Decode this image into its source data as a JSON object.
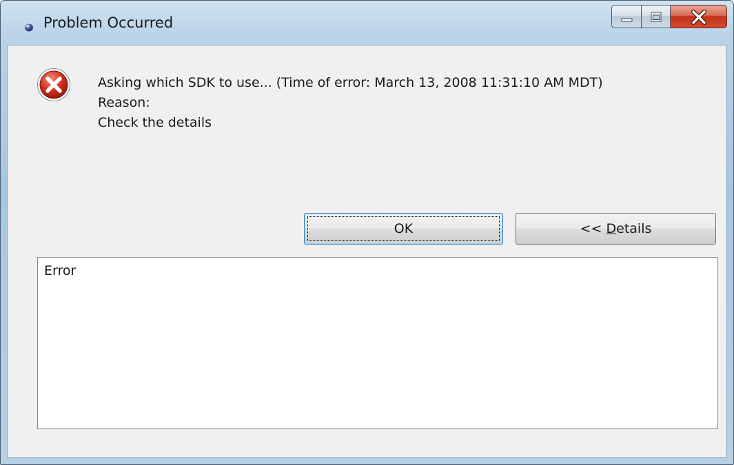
{
  "window": {
    "title": "Problem Occurred",
    "caption_buttons": [
      "minimize-icon",
      "maximize-icon",
      "close-icon"
    ],
    "accent_close": "#c2321a"
  },
  "message": {
    "icon": "error-icon",
    "line1": "Asking which SDK to use... (Time of error: March 13, 2008 11:31:10 AM MDT)",
    "line2": "Reason:",
    "line3": "Check the details"
  },
  "buttons": {
    "ok_label": "OK",
    "details_prefix": "<< ",
    "details_mnemonic": "D",
    "details_rest": "etails"
  },
  "details": {
    "text": "Error"
  }
}
